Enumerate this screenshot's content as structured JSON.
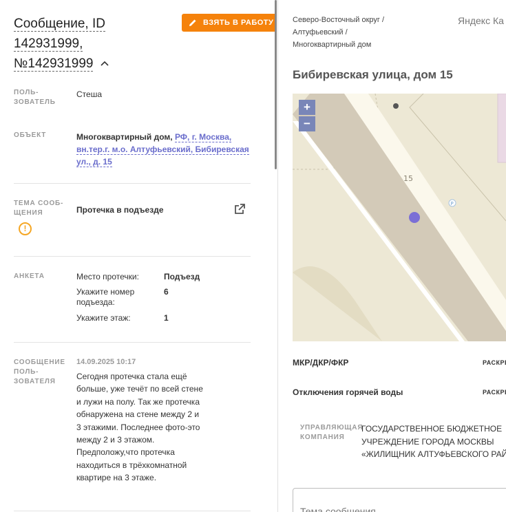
{
  "message": {
    "title_line1": "Сообщение, ID",
    "title_line2": "142931999,",
    "title_line3": "№142931999",
    "take_button": "ВЗЯТЬ В РАБОТУ"
  },
  "fields": {
    "user_label_1": "ПОЛЬ-",
    "user_label_2": "ЗОВАТЕЛЬ",
    "user_value": "Стеша",
    "object_label": "ОБЪЕКТ",
    "object_type": "Многоквартирный дом,",
    "object_addr_1": "РФ, г. Москва,",
    "object_addr_2": "вн.тер.г. м.о. Алтуфьевский, Бибиревская",
    "object_addr_3": "ул., д. 15",
    "topic_label_1": "ТЕМА СООБ-",
    "topic_label_2": "ЩЕНИЯ",
    "topic_value": "Протечка в подъезде",
    "form_label": "АНКЕТА",
    "msg_label_1": "СООБЩЕНИЕ",
    "msg_label_2": "ПОЛЬ-",
    "msg_label_3": "ЗОВАТЕЛЯ"
  },
  "questionnaire": [
    {
      "q1": "Место протечки:",
      "q2": "",
      "a": "Подъезд"
    },
    {
      "q1": "Укажите номер",
      "q2": "подъезда:",
      "a": "6"
    },
    {
      "q1": "Укажите этаж:",
      "q2": "",
      "a": "1"
    }
  ],
  "user_message": {
    "date": "14.09.2025 10:17",
    "text": "Сегодня протечка стала ещё больше, уже течёт по всей стене и лужи на полу. Так же протечка обнаружена на стене между 2 и 3 этажими. Последнее фото-это между 2 и 3 этажом. Предположу,что протечка находиться в трёхкомнатной квартире на 3 этаже."
  },
  "right": {
    "breadcrumb_1": "Северо-Восточный округ /",
    "breadcrumb_2": "Алтуфьевский /",
    "breadcrumb_3": "Многоквартирный дом",
    "yandex": "Яндекс Ка",
    "address": "Бибиревская улица, дом 15",
    "map": {
      "house_number": "15",
      "parking": "P",
      "zoom_in": "+",
      "zoom_out": "−"
    },
    "mkr_label": "МКР/ДКР/ФКР",
    "mkr_link": "РАСКРЕ",
    "hot_water_label": "Отключения горячей воды",
    "hot_water_link": "РАСКРЕ",
    "uk_label_1": "УПРАВЛЯЮЩАЯ",
    "uk_label_2": "КОМПАНИЯ",
    "uk_value_1": "ГОСУДАРСТВЕННОЕ БЮДЖЕТНОЕ",
    "uk_value_2": "УЧРЕЖДЕНИЕ ГОРОДА МОСКВЫ",
    "uk_value_3": "«ЖИЛИЩНИК АЛТУФЬЕВСКОГО РАЙ",
    "subject_placeholder": "Тема сообщения"
  },
  "colors": {
    "accent": "#f5820b",
    "link": "#6a6dcc",
    "warning": "#f5a623",
    "map_marker": "#7b6fd6"
  }
}
